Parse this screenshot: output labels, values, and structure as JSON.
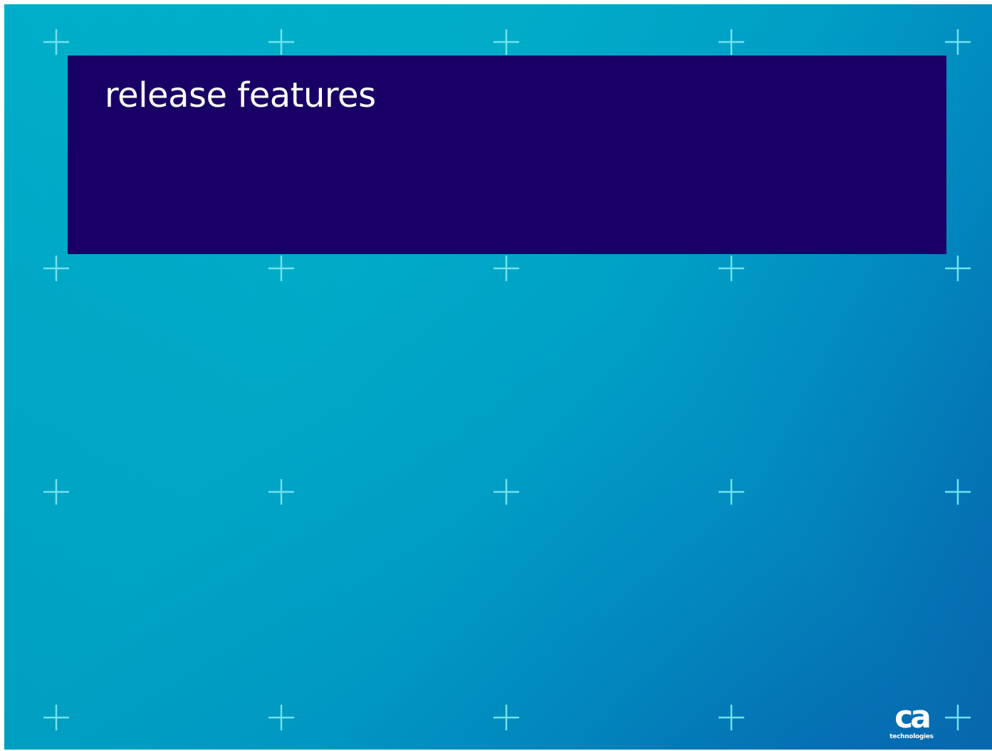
{
  "slide": {
    "title": "release features"
  },
  "logo": {
    "mark": "ca",
    "subtitle": "technologies"
  },
  "colors": {
    "title_box": "#190066",
    "background_light": "#00aec9",
    "background_dark": "#0568b0",
    "cross_marks": "#6fe3f0",
    "text": "#ffffff"
  }
}
